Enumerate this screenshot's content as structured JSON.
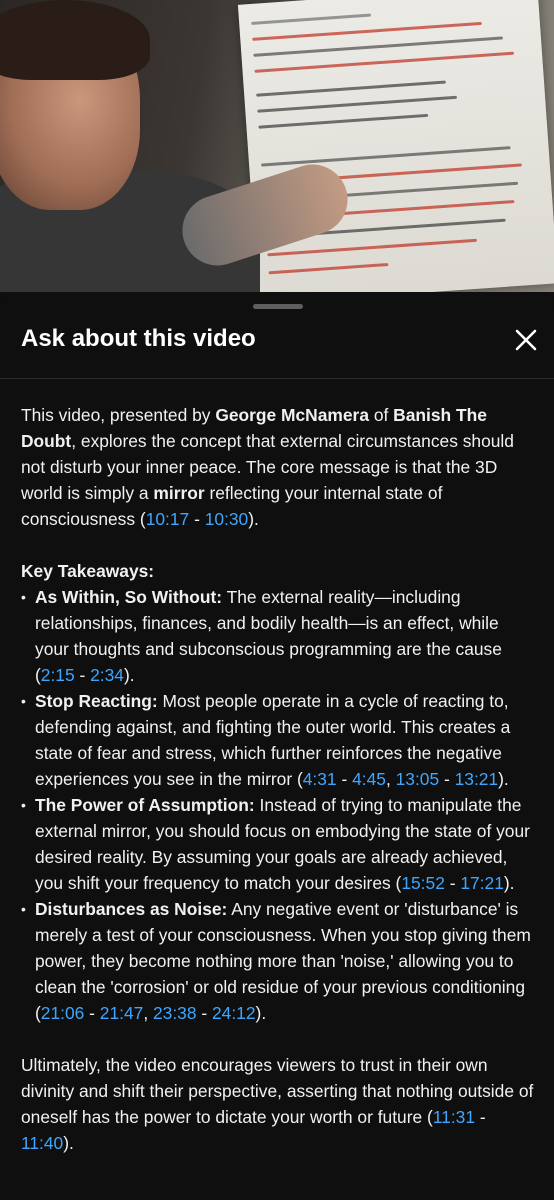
{
  "panel": {
    "title": "Ask about this video"
  },
  "video": {
    "whiteboard_lines": [
      "THE OUTER",
      "IT REFLECTS YOUR INNER",
      "YOU IN THE FORM OF CIRCUMSTANCES",
      "EVENTS AND THE BEHAVIOR OF OTHER PEOPLE",
      "THE WORLD IS A MIRROR",
      "FOREVER REFLECTING WHAT YOU",
      "ARE DOING INSIDE YOURSELF",
      "NEVILLE",
      "THIS MEANS - IF THE WORLD AROUND YOU IS",
      "DISTURBING IT IS NOT DELIVERING A VERDICT ABOUT",
      "YOUR WORTH - OR YOUR FUTURE - IT IS SHOWING",
      "YOU THE STATE OF CONSCIOUSNESS YOU CURRENTLY",
      "OCCUPY - MOST PEOPLE CANNOT CHANGE THE",
      "THEY CANNOT STOP REACTING TO WHAT",
      "IN THE MIRROR"
    ]
  },
  "summary": {
    "intro_1": "This video, presented by ",
    "presenter": "George McNamera",
    "intro_2": " of ",
    "channel": "Banish The Doubt",
    "intro_3": ", explores the concept that external circumstances should not disturb your inner peace. The core message is that the 3D world is simply a ",
    "keyword": "mirror",
    "intro_4": " reflecting your internal state of consciousness (",
    "ts_a1": "10:17",
    "sep": " - ",
    "ts_a2": "10:30",
    "intro_end": ").",
    "takeaways_heading": "Key Takeaways:",
    "takeaways": [
      {
        "title": "As Within, So Without:",
        "text": " The external reality—including relationships, finances, and bodily health—is an effect, while your thoughts and subconscious programming are the cause (",
        "ts1": "2:15",
        "ts2": "2:34",
        "end": ")."
      },
      {
        "title": "Stop Reacting:",
        "text": " Most people operate in a cycle of reacting to, defending against, and fighting the outer world. This creates a state of fear and stress, which further reinforces the negative experiences you see in the mirror (",
        "ts1": "4:31",
        "ts2": "4:45",
        "mid": ", ",
        "ts3": "13:05",
        "ts4": "13:21",
        "end": ")."
      },
      {
        "title": "The Power of Assumption:",
        "text": " Instead of trying to manipulate the external mirror, you should focus on embodying the state of your desired reality. By assuming your goals are already achieved, you shift your frequency to match your desires (",
        "ts1": "15:52",
        "ts2": "17:21",
        "end": ")."
      },
      {
        "title": "Disturbances as Noise:",
        "text": " Any negative event or 'disturbance' is merely a test of your consciousness. When you stop giving them power, they become nothing more than 'noise,' allowing you to clean the 'corrosion' or old residue of your previous conditioning (",
        "ts1": "21:06",
        "ts2": "21:47",
        "mid": ", ",
        "ts3": "23:38",
        "ts4": "24:12",
        "end": ")."
      }
    ],
    "conclusion": "Ultimately, the video encourages viewers to trust in their own divinity and shift their perspective, asserting that nothing outside of oneself has the power to dictate your worth or future (",
    "ts_z1": "11:31",
    "ts_z2": "11:40",
    "conclusion_end": ")."
  },
  "colors": {
    "background": "#0f0f0f",
    "text": "#f1f1f1",
    "link": "#3ea6ff"
  }
}
